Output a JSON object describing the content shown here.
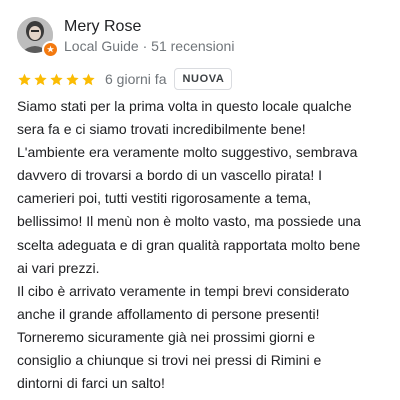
{
  "review": {
    "author": {
      "name": "Mery Rose",
      "meta": "Local Guide · 51 recensioni",
      "avatar_icon": "profile-photo",
      "badge_icon": "local-guide-star-icon",
      "badge_color": "#f3790f"
    },
    "rating": {
      "stars": 5,
      "max": 5,
      "star_color": "#fbbc04",
      "star_icon": "star-icon"
    },
    "time": "6 giorni fa",
    "badge": "NUOVA",
    "text": "Siamo stati per la prima volta in questo locale qualche\nsera fa e ci siamo trovati incredibilmente bene!\nL'ambiente era veramente molto suggestivo, sembrava\ndavvero di trovarsi a bordo di un vascello pirata! I\ncamerieri poi, tutti vestiti rigorosamente a tema,\nbellissimo! Il menù non è molto vasto, ma possiede una\nscelta adeguata e di gran qualità rapportata molto bene\nai vari prezzi.\nIl cibo è arrivato veramente in tempi brevi considerato\nanche il grande affollamento di persone presenti!\nTorneremo sicuramente già nei prossimi giorni e\nconsiglio a chiunque si trovi nei pressi di Rimini e\ndintorni di farci un salto!"
  }
}
